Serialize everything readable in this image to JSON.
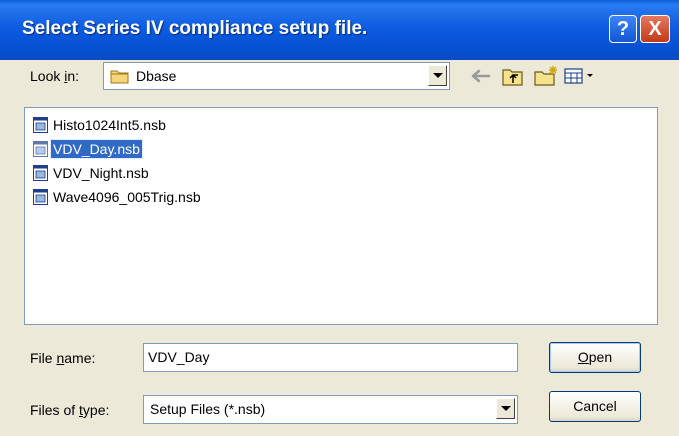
{
  "window": {
    "title": "Select Series IV compliance setup file.",
    "help_label": "?",
    "close_label": "X"
  },
  "lookin": {
    "label_pre": "Look ",
    "label_accel": "i",
    "label_post": "n:",
    "value": "Dbase",
    "icon": "folder-icon"
  },
  "toolbar": {
    "icons": [
      "back-arrow-icon",
      "up-folder-icon",
      "new-folder-icon",
      "view-menu-icon"
    ]
  },
  "files": [
    {
      "name": "Histo1024Int5.nsb",
      "selected": false,
      "icon": "nsb-file-icon"
    },
    {
      "name": "VDV_Day.nsb",
      "selected": true,
      "icon": "nsb-file-icon"
    },
    {
      "name": "VDV_Night.nsb",
      "selected": false,
      "icon": "nsb-file-icon"
    },
    {
      "name": "Wave4096_005Trig.nsb",
      "selected": false,
      "icon": "nsb-file-icon"
    }
  ],
  "filename": {
    "label_pre": "File ",
    "label_accel": "n",
    "label_post": "ame:",
    "value": "VDV_Day"
  },
  "filetype": {
    "label_pre": "Files of ",
    "label_accel": "t",
    "label_post": "ype:",
    "value": "Setup Files (*.nsb)"
  },
  "buttons": {
    "open_accel": "O",
    "open_rest": "pen",
    "cancel": "Cancel"
  },
  "colors": {
    "titlebar": "#0552d6",
    "selection": "#316ac5",
    "dialog_bg": "#ece9d8"
  }
}
